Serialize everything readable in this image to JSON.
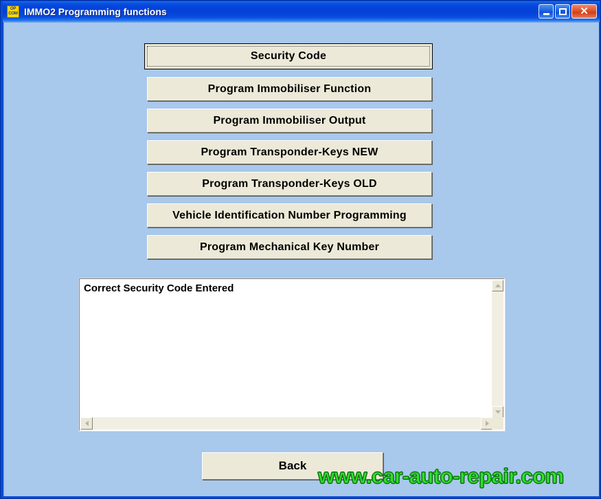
{
  "window": {
    "title": "IMMO2 Programming functions",
    "icon_line1": "OP",
    "icon_line2": "COM",
    "icon_name": "opcom-logo-icon",
    "background_color": "#A8C8EC",
    "titlebar_color": "#0A4ADC"
  },
  "titlebar_controls": {
    "minimize_label": "–",
    "maximize_label": "□",
    "close_label": "✕"
  },
  "function_buttons": [
    {
      "label": "Security Code",
      "name": "security-code-button",
      "focused": true
    },
    {
      "label": "Program Immobiliser Function",
      "name": "program-immobiliser-function-button",
      "focused": false
    },
    {
      "label": "Program Immobiliser Output",
      "name": "program-immobiliser-output-button",
      "focused": false
    },
    {
      "label": "Program Transponder-Keys NEW",
      "name": "program-transponder-keys-new-button",
      "focused": false
    },
    {
      "label": "Program Transponder-Keys OLD",
      "name": "program-transponder-keys-old-button",
      "focused": false
    },
    {
      "label": "Vehicle Identification Number Programming",
      "name": "vin-programming-button",
      "focused": false
    },
    {
      "label": "Program Mechanical Key Number",
      "name": "program-mechanical-key-number-button",
      "focused": false
    }
  ],
  "output": {
    "lines": [
      "Correct Security Code Entered"
    ],
    "scroll_up_glyph": "▲",
    "scroll_down_glyph": "▼",
    "scroll_left_glyph": "◄",
    "scroll_right_glyph": "►"
  },
  "footer": {
    "back_label": "Back"
  },
  "watermark": {
    "text": "www.car-auto-repair.com",
    "color": "#2EE02E"
  }
}
